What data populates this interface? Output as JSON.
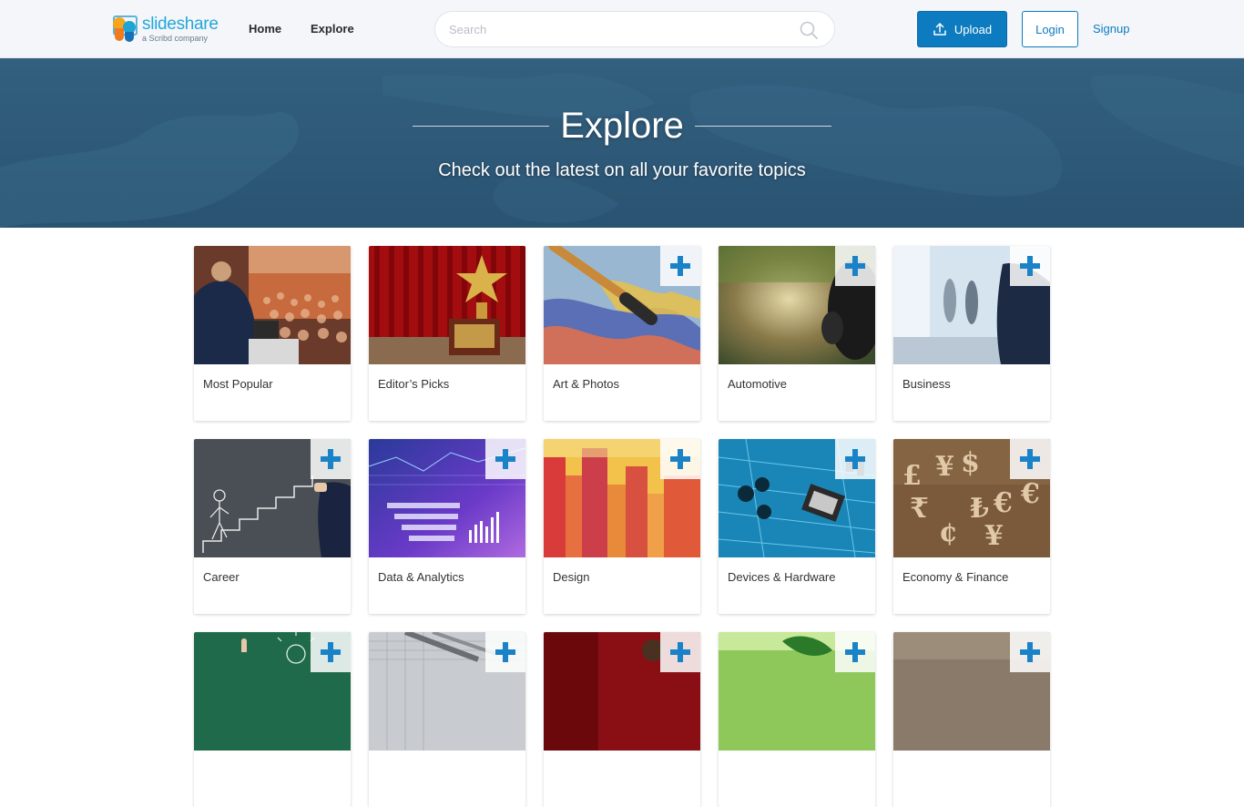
{
  "brand": {
    "name": "slideshare",
    "sub": "a Scribd company"
  },
  "nav": {
    "home": "Home",
    "explore": "Explore"
  },
  "search": {
    "placeholder": "Search",
    "value": ""
  },
  "actions": {
    "upload": "Upload",
    "login": "Login",
    "signup": "Signup"
  },
  "hero": {
    "title": "Explore",
    "subtitle": "Check out the latest on all your favorite topics"
  },
  "categories": [
    {
      "label": "Most Popular",
      "followable": false
    },
    {
      "label": "Editor’s Picks",
      "followable": false
    },
    {
      "label": "Art & Photos",
      "followable": true
    },
    {
      "label": "Automotive",
      "followable": true
    },
    {
      "label": "Business",
      "followable": true
    },
    {
      "label": "Career",
      "followable": true
    },
    {
      "label": "Data & Analytics",
      "followable": true
    },
    {
      "label": "Design",
      "followable": true
    },
    {
      "label": "Devices & Hardware",
      "followable": true
    },
    {
      "label": "Economy & Finance",
      "followable": true
    },
    {
      "label": "",
      "followable": true
    },
    {
      "label": "",
      "followable": true
    },
    {
      "label": "",
      "followable": true
    },
    {
      "label": "",
      "followable": true
    },
    {
      "label": "",
      "followable": true
    }
  ],
  "icons": {
    "search": "search-icon",
    "upload": "upload-icon",
    "follow": "plus-icon"
  },
  "colors": {
    "accent": "#0d7bbf",
    "hero": "#2e5a78",
    "header_bg": "#f4f6fa"
  }
}
